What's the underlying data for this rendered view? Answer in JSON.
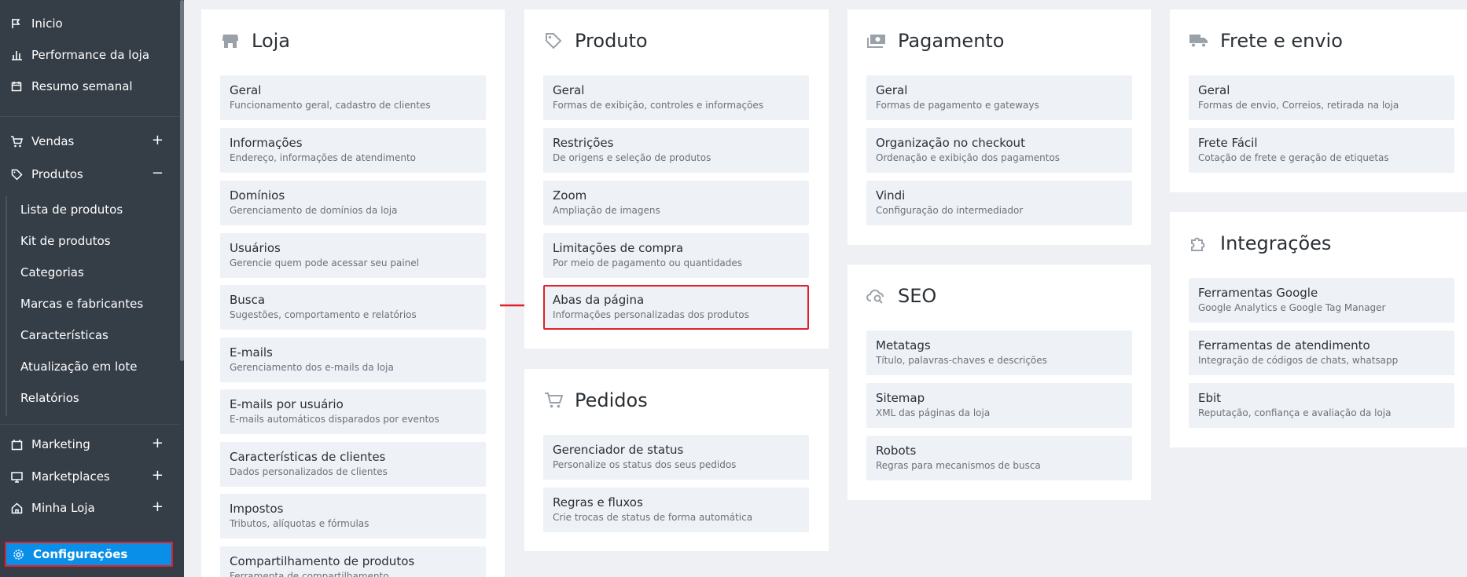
{
  "sidebar": {
    "items": [
      {
        "label": "Inicio",
        "icon": "flag-icon"
      },
      {
        "label": "Performance da loja",
        "icon": "bar-chart-icon"
      },
      {
        "label": "Resumo semanal",
        "icon": "calendar-icon"
      },
      {
        "label": "Vendas",
        "icon": "cart-icon",
        "toggle": "+"
      },
      {
        "label": "Produtos",
        "icon": "tag-icon",
        "toggle": "−"
      },
      {
        "label": "Marketing",
        "icon": "marketing-icon",
        "toggle": "+"
      },
      {
        "label": "Marketplaces",
        "icon": "monitor-icon",
        "toggle": "+"
      },
      {
        "label": "Minha Loja",
        "icon": "store-icon",
        "toggle": "+"
      }
    ],
    "sub_items": [
      "Lista de produtos",
      "Kit de produtos",
      "Categorias",
      "Marcas e fabricantes",
      "Características",
      "Atualização em lote",
      "Relatórios"
    ],
    "active": {
      "label": "Configurações",
      "icon": "gear-icon"
    }
  },
  "panels": {
    "loja": {
      "title": "Loja",
      "cards": [
        {
          "title": "Geral",
          "desc": "Funcionamento geral, cadastro de clientes"
        },
        {
          "title": "Informações",
          "desc": "Endereço, informações de atendimento"
        },
        {
          "title": "Domínios",
          "desc": "Gerenciamento de domínios da loja"
        },
        {
          "title": "Usuários",
          "desc": "Gerencie quem pode acessar seu painel"
        },
        {
          "title": "Busca",
          "desc": "Sugestões, comportamento e relatórios"
        },
        {
          "title": "E-mails",
          "desc": "Gerenciamento dos e-mails da loja"
        },
        {
          "title": "E-mails por usuário",
          "desc": "E-mails automáticos disparados por eventos"
        },
        {
          "title": "Características de clientes",
          "desc": "Dados personalizados de clientes"
        },
        {
          "title": "Impostos",
          "desc": "Tributos, alíquotas e fórmulas"
        },
        {
          "title": "Compartilhamento de produtos",
          "desc": "Ferramenta de compartilhamento"
        }
      ]
    },
    "produto": {
      "title": "Produto",
      "cards": [
        {
          "title": "Geral",
          "desc": "Formas de exibição, controles e informações"
        },
        {
          "title": "Restrições",
          "desc": "De origens e seleção de produtos"
        },
        {
          "title": "Zoom",
          "desc": "Ampliação de imagens"
        },
        {
          "title": "Limitações de compra",
          "desc": "Por meio de pagamento ou quantidades"
        },
        {
          "title": "Abas da página",
          "desc": "Informações personalizadas dos produtos"
        }
      ]
    },
    "pedidos": {
      "title": "Pedidos",
      "cards": [
        {
          "title": "Gerenciador de status",
          "desc": "Personalize os status dos seus pedidos"
        },
        {
          "title": "Regras e fluxos",
          "desc": "Crie trocas de status de forma automática"
        }
      ]
    },
    "pagamento": {
      "title": "Pagamento",
      "cards": [
        {
          "title": "Geral",
          "desc": "Formas de pagamento e gateways"
        },
        {
          "title": "Organização no checkout",
          "desc": "Ordenação e exibição dos pagamentos"
        },
        {
          "title": "Vindi",
          "desc": "Configuração do intermediador"
        }
      ]
    },
    "seo": {
      "title": "SEO",
      "cards": [
        {
          "title": "Metatags",
          "desc": "Título, palavras-chaves e descrições"
        },
        {
          "title": "Sitemap",
          "desc": "XML das páginas da loja"
        },
        {
          "title": "Robots",
          "desc": "Regras para mecanismos de busca"
        }
      ]
    },
    "frete": {
      "title": "Frete e envio",
      "cards": [
        {
          "title": "Geral",
          "desc": "Formas de envio, Correios, retirada na loja"
        },
        {
          "title": "Frete Fácil",
          "desc": "Cotação de frete e geração de etiquetas"
        }
      ]
    },
    "integracoes": {
      "title": "Integrações",
      "cards": [
        {
          "title": "Ferramentas Google",
          "desc": "Google Analytics e Google Tag Manager"
        },
        {
          "title": "Ferramentas de atendimento",
          "desc": "Integração de códigos de chats, whatsapp"
        },
        {
          "title": "Ebit",
          "desc": "Reputação, confiança e avaliação da loja"
        }
      ]
    }
  },
  "colors": {
    "sidebar_bg": "#353d47",
    "active_bg": "#0a8fe8",
    "highlight": "#e0202a",
    "card_bg": "#eef1f5"
  }
}
